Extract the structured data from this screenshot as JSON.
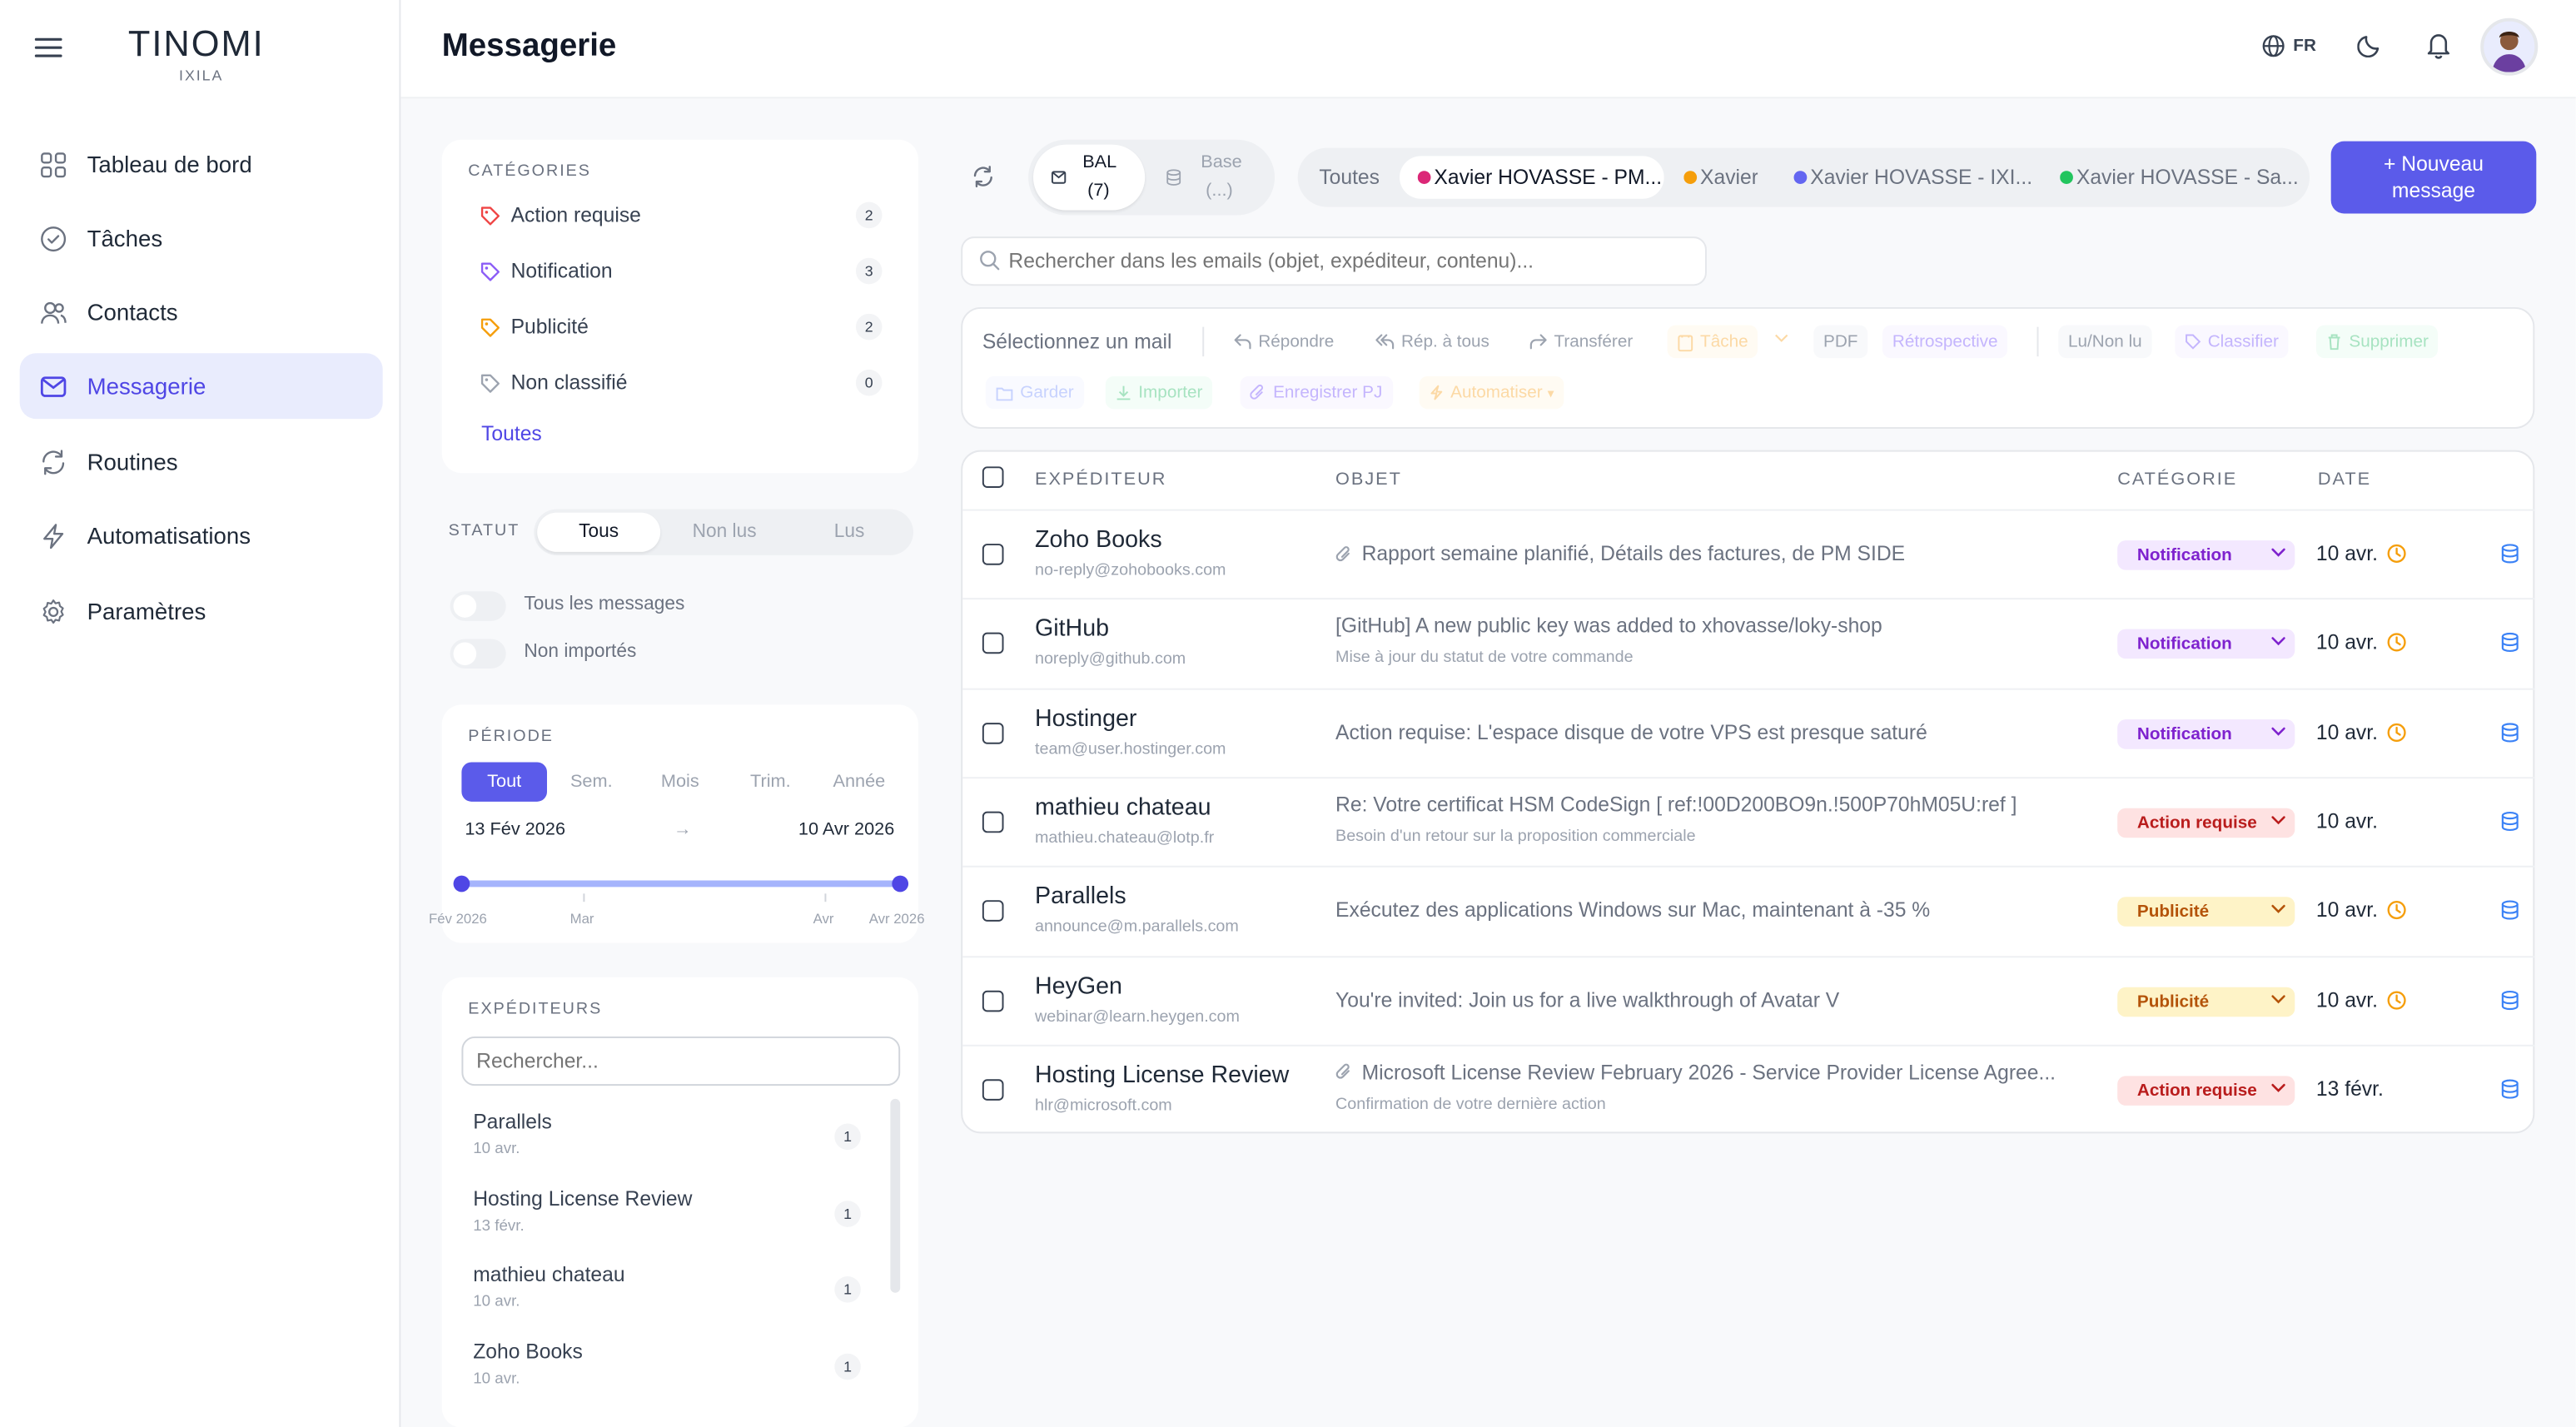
{
  "brand": {
    "name": "TINOMI",
    "sub": "IXILA"
  },
  "nav": [
    {
      "label": "Tableau de bord",
      "icon": "dashboard-icon"
    },
    {
      "label": "Tâches",
      "icon": "check-circle-icon"
    },
    {
      "label": "Contacts",
      "icon": "users-icon"
    },
    {
      "label": "Messagerie",
      "icon": "mail-icon",
      "active": true
    },
    {
      "label": "Routines",
      "icon": "refresh-icon"
    },
    {
      "label": "Automatisations",
      "icon": "bolt-icon"
    },
    {
      "label": "Paramètres",
      "icon": "gear-icon"
    }
  ],
  "header": {
    "title": "Messagerie",
    "lang": "FR"
  },
  "categories": {
    "title": "CATÉGORIES",
    "items": [
      {
        "label": "Action requise",
        "count": "2",
        "color": "#ef4444"
      },
      {
        "label": "Notification",
        "count": "3",
        "color": "#8b5cf6"
      },
      {
        "label": "Publicité",
        "count": "2",
        "color": "#f59e0b"
      },
      {
        "label": "Non classifié",
        "count": "0",
        "color": "#9ca3af"
      }
    ],
    "all_label": "Toutes"
  },
  "status": {
    "label": "STATUT",
    "options": [
      "Tous",
      "Non lus",
      "Lus"
    ],
    "selected": "Tous",
    "toggles": [
      "Tous les messages",
      "Non importés"
    ]
  },
  "period": {
    "title": "PÉRIODE",
    "options": [
      "Tout",
      "Sem.",
      "Mois",
      "Trim.",
      "Année"
    ],
    "selected": "Tout",
    "from": "13 Fév 2026",
    "arrow": "→",
    "to": "10 Avr 2026",
    "ticks": [
      "Fév 2026",
      "Mar",
      "Avr",
      "Avr 2026"
    ]
  },
  "senders": {
    "title": "EXPÉDITEURS",
    "placeholder": "Rechercher...",
    "items": [
      {
        "name": "Parallels",
        "date": "10 avr.",
        "count": "1"
      },
      {
        "name": "Hosting License Review",
        "date": "13 févr.",
        "count": "1"
      },
      {
        "name": "mathieu chateau",
        "date": "10 avr.",
        "count": "1"
      },
      {
        "name": "Zoho Books",
        "date": "10 avr.",
        "count": "1"
      }
    ]
  },
  "mailbox": {
    "bal_label": "BAL",
    "bal_count": "(7)",
    "base_label": "Base",
    "base_count": "(...)"
  },
  "accounts": {
    "all": "Toutes",
    "items": [
      {
        "label": "Xavier HOVASSE - PM...",
        "color": "#db2777",
        "active": true
      },
      {
        "label": "Xavier",
        "color": "#f59e0b"
      },
      {
        "label": "Xavier HOVASSE - IXI...",
        "color": "#6366f1"
      },
      {
        "label": "Xavier HOVASSE - Sa...",
        "color": "#22c55e"
      }
    ]
  },
  "new_message": {
    "line1": "+ Nouveau",
    "line2": "message"
  },
  "search": {
    "placeholder": "Rechercher dans les emails (objet, expéditeur, contenu)..."
  },
  "toolbar": {
    "select_label": "Sélectionnez un mail",
    "reply": "Répondre",
    "reply_all": "Rép. à tous",
    "forward": "Transférer",
    "task": "Tâche",
    "pdf": "PDF",
    "retro": "Rétrospective",
    "read_toggle": "Lu/Non lu",
    "classify": "Classifier",
    "delete": "Supprimer",
    "keep": "Garder",
    "import": "Importer",
    "save_attachments": "Enregistrer PJ",
    "automate": "Automatiser",
    "automate_caret": "▾"
  },
  "table": {
    "headers": {
      "sender": "EXPÉDITEUR",
      "subject": "OBJET",
      "category": "CATÉGORIE",
      "date": "DATE"
    },
    "rows": [
      {
        "sender": "Zoho Books",
        "email": "no-reply@zohobooks.com",
        "subject": "Rapport semaine planifié, Détails des factures, de PM SIDE",
        "subject2": "",
        "attach": true,
        "category": "Notification",
        "date": "10 avr.",
        "clock": true
      },
      {
        "sender": "GitHub",
        "email": "noreply@github.com",
        "subject": "[GitHub] A new public key was added to xhovasse/loky-shop",
        "subject2": "Mise à jour du statut de votre commande",
        "attach": false,
        "category": "Notification",
        "date": "10 avr.",
        "clock": true
      },
      {
        "sender": "Hostinger",
        "email": "team@user.hostinger.com",
        "subject": "Action requise: L'espace disque de votre VPS est presque saturé",
        "subject2": "",
        "attach": false,
        "category": "Notification",
        "date": "10 avr.",
        "clock": true
      },
      {
        "sender": "mathieu chateau",
        "email": "mathieu.chateau@lotp.fr",
        "subject": "Re: Votre certificat HSM CodeSign [ ref:!00D200BO9n.!500P70hM05U:ref ]",
        "subject2": "Besoin d'un retour sur la proposition commerciale",
        "attach": false,
        "category": "Action requise",
        "date": "10 avr.",
        "clock": false
      },
      {
        "sender": "Parallels",
        "email": "announce@m.parallels.com",
        "subject": "Exécutez des applications Windows sur Mac, maintenant à -35 %",
        "subject2": "",
        "attach": false,
        "category": "Publicité",
        "date": "10 avr.",
        "clock": true
      },
      {
        "sender": "HeyGen",
        "email": "webinar@learn.heygen.com",
        "subject": "You're invited: Join us for a live walkthrough of Avatar V",
        "subject2": "",
        "attach": false,
        "category": "Publicité",
        "date": "10 avr.",
        "clock": true
      },
      {
        "sender": "Hosting License Review",
        "email": "hlr@microsoft.com",
        "subject": "Microsoft License Review February 2026 - Service Provider License Agree...",
        "subject2": "Confirmation de votre dernière action",
        "attach": true,
        "category": "Action requise",
        "date": "13 févr.",
        "clock": false
      }
    ]
  },
  "category_colors": {
    "Notification": {
      "bg": "#f3e8ff",
      "fg": "#7e22ce"
    },
    "Action requise": {
      "bg": "#fee2e2",
      "fg": "#b91c1c"
    },
    "Publicité": {
      "bg": "#fef3c7",
      "fg": "#b45309"
    }
  }
}
